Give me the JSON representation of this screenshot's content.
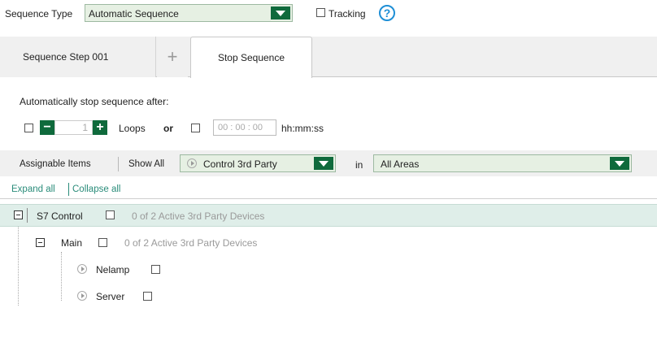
{
  "header": {
    "sequence_type_label": "Sequence Type",
    "sequence_type_value": "Automatic Sequence",
    "tracking_label": "Tracking",
    "help_icon_text": "?"
  },
  "tabs": {
    "step_label": "Sequence Step 001",
    "add_symbol": "+",
    "stop_label": "Stop Sequence"
  },
  "stop_panel": {
    "heading": "Automatically stop sequence after:",
    "loops_value": "1",
    "minus_symbol": "−",
    "plus_symbol": "+",
    "loops_label": "Loops",
    "or_label": "or",
    "time_value": "00 : 00 : 00",
    "time_format_label": "hh:mm:ss"
  },
  "filter_bar": {
    "assignable_label": "Assignable Items",
    "show_all_label": "Show All",
    "type_value": "Control 3rd Party",
    "in_label": "in",
    "area_value": "All Areas"
  },
  "tree_actions": {
    "expand_all": "Expand all",
    "collapse_all": "Collapse all"
  },
  "tree": {
    "root": {
      "label": "S7 Control",
      "status": "0 of 2 Active 3rd Party Devices"
    },
    "main": {
      "label": "Main",
      "status": "0 of 2 Active 3rd Party Devices"
    },
    "leaves": [
      {
        "label": "Nelamp"
      },
      {
        "label": "Server"
      }
    ]
  },
  "colors": {
    "accent_green": "#0f6a3c",
    "selected_row": "#dfeee9",
    "link": "#2a8c7a"
  }
}
